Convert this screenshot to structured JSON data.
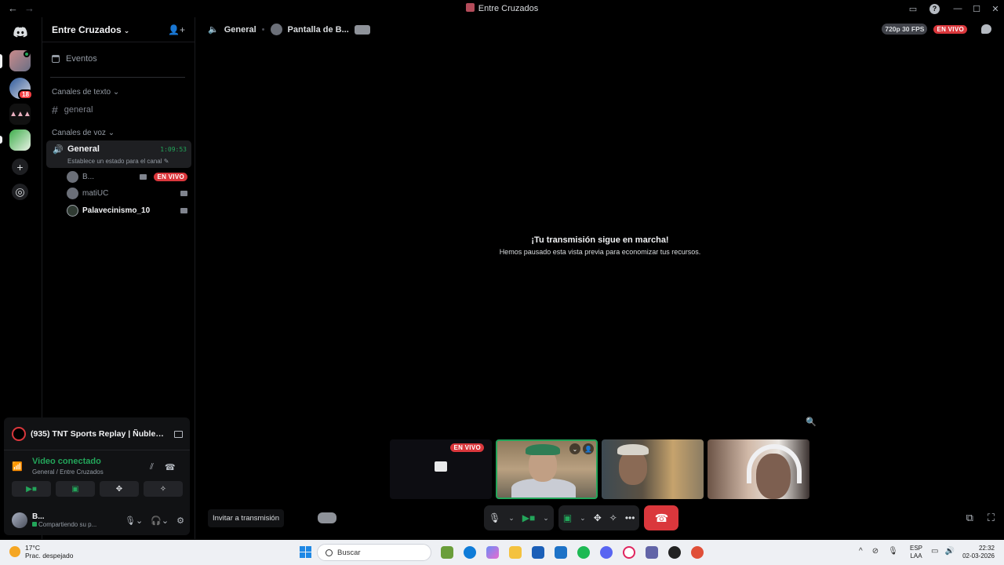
{
  "window": {
    "title": "Entre Cruzados",
    "back": "←",
    "forward": "→"
  },
  "rail": {
    "badge_count": "18"
  },
  "sidebar": {
    "guild_name": "Entre Cruzados",
    "events_label": "Eventos",
    "text_category": "Canales de texto",
    "text_channel": "general",
    "voice_category": "Canales de voz",
    "voice_channel": {
      "name": "General",
      "timer": "1:09:53",
      "status": "Establece un estado para el canal"
    },
    "voice_users": [
      {
        "name": "B...",
        "live": "EN VIVO"
      },
      {
        "name": "matiUC"
      },
      {
        "name": "Palavecinismo_10"
      }
    ]
  },
  "activity": {
    "title": "(935) TNT Sports Replay | Ñublens...",
    "connection_status": "Video conectado",
    "connection_location": "General / Entre Cruzados"
  },
  "user": {
    "name": "B...",
    "status": "Compartiendo su p..."
  },
  "main": {
    "crumb_channel": "General",
    "crumb_stream": "Pantalla de B...",
    "quality": "720p 30 FPS",
    "live": "EN VIVO",
    "paused_title": "¡Tu transmisión sigue en marcha!",
    "paused_sub": "Hemos pausado esta vista previa para economizar tus recursos.",
    "tile_live": "EN VIVO",
    "invite": "Invitar a transmisión"
  },
  "taskbar": {
    "temp": "17°C",
    "weather": "Prac. despejado",
    "search_placeholder": "Buscar",
    "lang1": "ESP",
    "lang2": "LAA",
    "time": "22:32",
    "date": "02-03-2026"
  },
  "colors": {
    "accent_green": "#23a55a",
    "live_red": "#da373c",
    "background": "#000000"
  }
}
